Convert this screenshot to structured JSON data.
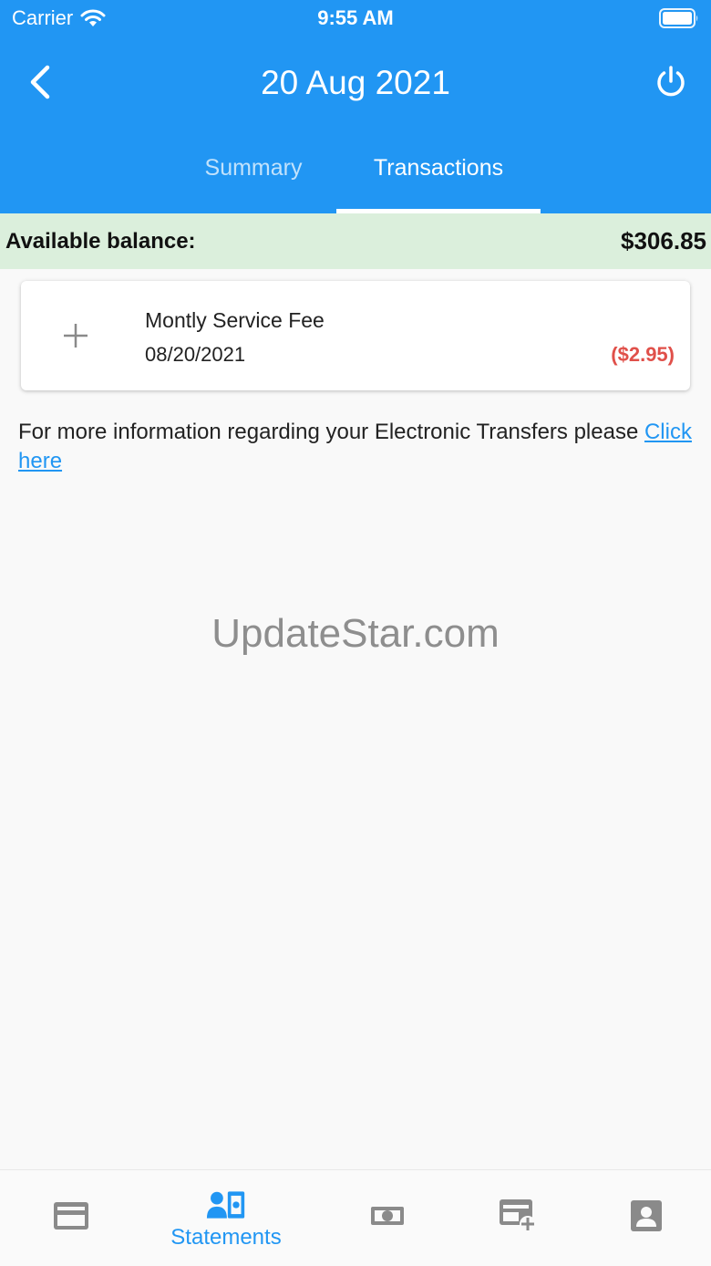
{
  "status_bar": {
    "carrier": "Carrier",
    "time": "9:55 AM"
  },
  "header": {
    "title": "20 Aug 2021"
  },
  "tabs": [
    {
      "label": "Summary",
      "active": false
    },
    {
      "label": "Transactions",
      "active": true
    }
  ],
  "balance": {
    "label": "Available balance:",
    "value": "$306.85"
  },
  "transactions": [
    {
      "name": "Montly Service Fee",
      "date": "08/20/2021",
      "amount": "($2.95)"
    }
  ],
  "info": {
    "text": "For more information regarding your Electronic Transfers please ",
    "link": "Click here"
  },
  "watermark": "UpdateStar.com",
  "bottom_nav": [
    {
      "icon": "credit-card-icon",
      "label": ""
    },
    {
      "icon": "statements-icon",
      "label": "Statements",
      "active": true
    },
    {
      "icon": "money-icon",
      "label": ""
    },
    {
      "icon": "add-card-icon",
      "label": ""
    },
    {
      "icon": "contact-icon",
      "label": ""
    }
  ],
  "colors": {
    "primary": "#2196f3",
    "balance_bg": "#dbefdc",
    "negative_amount": "#e0504a",
    "nav_inactive": "#8a8a8a"
  }
}
